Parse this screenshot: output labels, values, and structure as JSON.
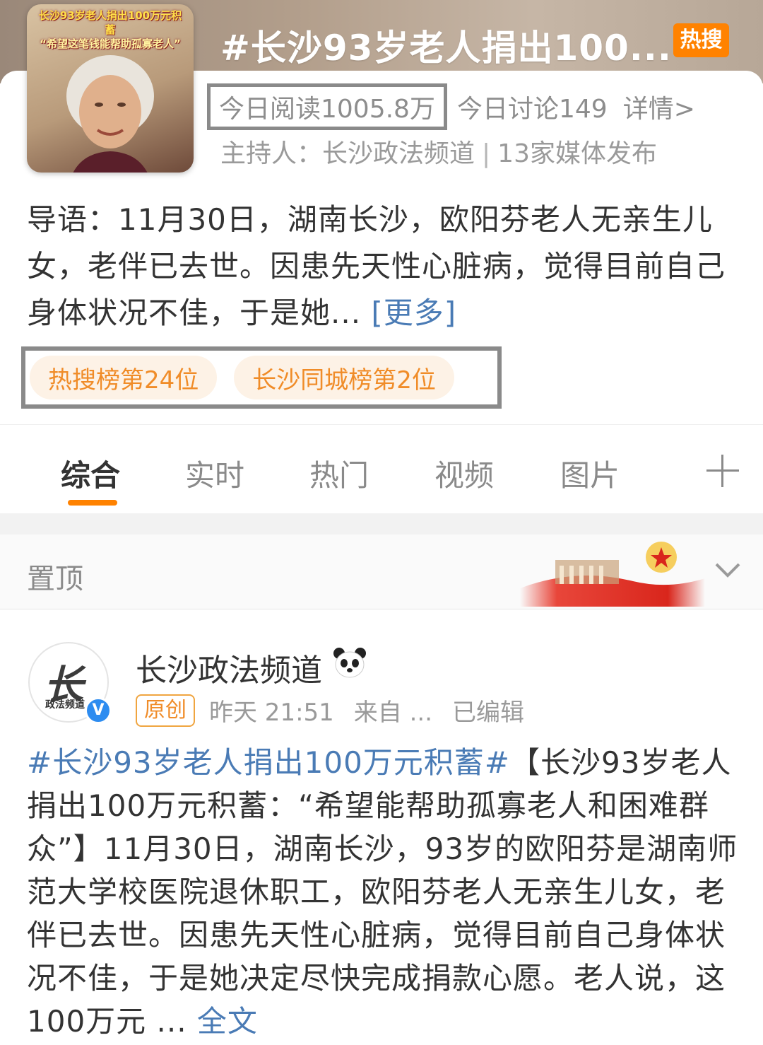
{
  "topic": {
    "cover_caption_top": "长沙93岁老人捐出100万元积蓄",
    "cover_caption_quote": "“希望这笔钱能帮助孤寡老人”",
    "title": "#长沙93岁老人捐出100...",
    "hot_badge": "热搜",
    "reads_today": "今日阅读1005.8万",
    "discussions_today": "今日讨论149",
    "details_link": "详情>",
    "host_label": "主持人：",
    "host_name": "长沙政法频道",
    "media_count": "13家媒体发布",
    "intro_text": "导语：11月30日，湖南长沙，欧阳芬老人无亲生儿女，老伴已去世。因患先天性心脏病，觉得目前自己身体状况不佳，于是她...",
    "intro_more": "[更多]",
    "ranks": [
      "热搜榜第24位",
      "长沙同城榜第2位"
    ]
  },
  "tabs": [
    "综合",
    "实时",
    "热门",
    "视频",
    "图片"
  ],
  "active_tab": "综合",
  "pinned": {
    "label": "置顶"
  },
  "post": {
    "avatar_text": "长",
    "avatar_subtext": "政法频道",
    "author": "长沙政法频道",
    "badge": "原创",
    "time": "昨天 21:51",
    "source": "来自 ...",
    "edited": "已编辑",
    "hashtag": "#长沙93岁老人捐出100万元积蓄#",
    "body": "【长沙93岁老人捐出100万元积蓄：“希望能帮助孤寡老人和困难群众”】11月30日，湖南长沙，93岁的欧阳芬是湖南师范大学校医院退休职工，欧阳芬老人无亲生儿女，老伴已去世。因患先天性心脏病，觉得目前自己身体状况不佳，于是她决定尽快完成捐款心愿。老人说，这100万元 ... ",
    "fulltext_link": "全文"
  },
  "colors": {
    "accent_orange": "#ff8200",
    "link_blue": "#4a7bb5",
    "rank_chip_bg": "#fdf2e6",
    "rank_chip_text": "#f08c28",
    "verified_blue": "#2d8cf0"
  }
}
